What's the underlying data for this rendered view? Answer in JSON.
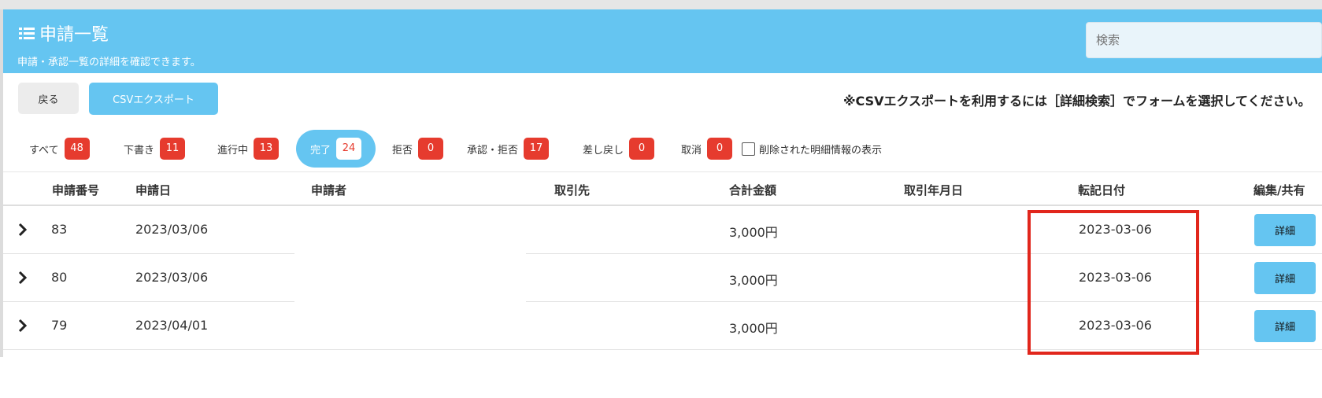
{
  "header": {
    "title": "申請一覧",
    "subtitle": "申請・承認一覧の詳細を確認できます。",
    "search_placeholder": "検索"
  },
  "toolbar": {
    "back_label": "戻る",
    "csv_label": "CSVエクスポート",
    "notice": "※CSVエクスポートを利用するには［詳細検索］でフォームを選択してください。"
  },
  "tabs": [
    {
      "label": "すべて",
      "count": "48"
    },
    {
      "label": "下書き",
      "count": "11"
    },
    {
      "label": "進行中",
      "count": "13"
    },
    {
      "label": "完了",
      "count": "24",
      "active": true
    },
    {
      "label": "拒否",
      "count": "0"
    },
    {
      "label": "承認・拒否",
      "count": "17"
    },
    {
      "label": "差し戻し",
      "count": "0"
    },
    {
      "label": "取消",
      "count": "0"
    }
  ],
  "show_deleted_label": "削除された明細情報の表示",
  "table": {
    "columns": [
      "申請番号",
      "申請日",
      "申請者",
      "取引先",
      "合計金額",
      "取引年月日",
      "転記日付",
      "編集/共有"
    ],
    "rows": [
      {
        "number": "83",
        "date": "2023/03/06",
        "applicant": "",
        "partner": "",
        "amount": "3,000円",
        "txn_date": "",
        "posting_date": "2023-03-06",
        "action": "詳細"
      },
      {
        "number": "80",
        "date": "2023/03/06",
        "applicant": "",
        "partner": "",
        "amount": "3,000円",
        "txn_date": "",
        "posting_date": "2023-03-06",
        "action": "詳細"
      },
      {
        "number": "79",
        "date": "2023/04/01",
        "applicant": "",
        "partner": "",
        "amount": "3,000円",
        "txn_date": "",
        "posting_date": "2023-03-06",
        "action": "詳細"
      }
    ]
  },
  "colors": {
    "accent": "#65c5f1",
    "badge": "#e63b2e",
    "highlight": "#e1261c"
  }
}
